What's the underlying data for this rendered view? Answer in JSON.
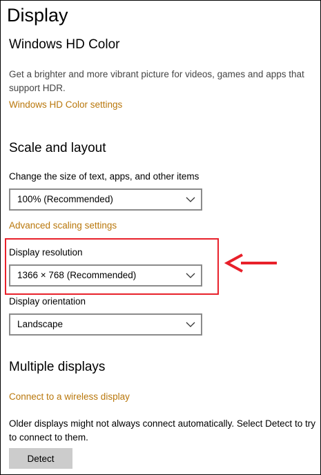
{
  "page": {
    "title": "Display"
  },
  "hd_color": {
    "heading": "Windows HD Color",
    "description": "Get a brighter and more vibrant picture for videos, games and apps that support HDR.",
    "settings_link": "Windows HD Color settings"
  },
  "scale_layout": {
    "heading": "Scale and layout",
    "scale_label": "Change the size of text, apps, and other items",
    "scale_value": "100% (Recommended)",
    "advanced_link": "Advanced scaling settings",
    "resolution_label": "Display resolution",
    "resolution_value": "1366 × 768 (Recommended)",
    "orientation_label": "Display orientation",
    "orientation_value": "Landscape"
  },
  "multiple_displays": {
    "heading": "Multiple displays",
    "wireless_link": "Connect to a wireless display",
    "description": "Older displays might not always connect automatically. Select Detect to try to connect to them.",
    "detect_label": "Detect"
  },
  "colors": {
    "accent_link": "#b9770b",
    "annotation": "#e8202a",
    "button_bg": "#cccccc"
  },
  "icons": {
    "dropdown": "chevron-down-icon",
    "annotation": "arrow-left-icon"
  }
}
